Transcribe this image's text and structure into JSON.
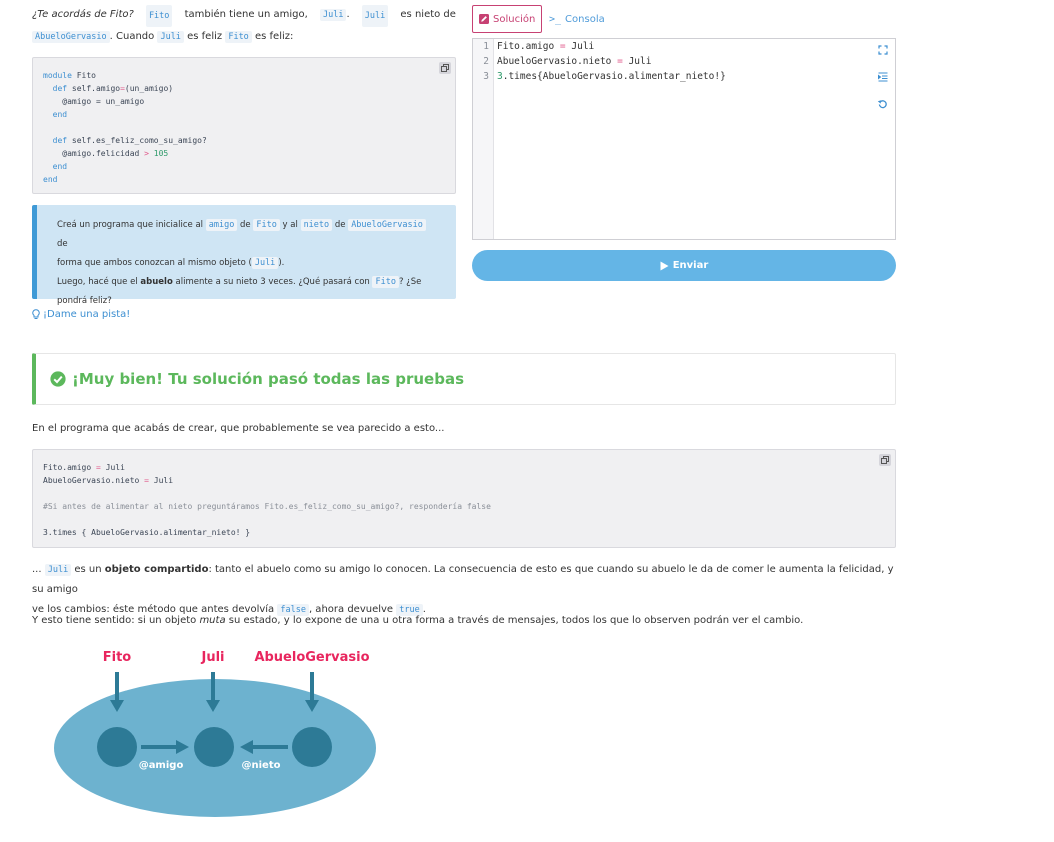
{
  "intro": {
    "q": "¿Te acordás de Fito?",
    "fito": "Fito",
    "t1": " también tiene un amigo, ",
    "juli": "Juli",
    "t2": ". ",
    "t3": " es nieto de",
    "abuelo": "AbueloGervasio",
    "t4": ". Cuando ",
    "t5": " es feliz ",
    "t6": " es feliz:"
  },
  "code1": {
    "l1_kw": "module",
    "l1_rest": " Fito",
    "l2_kw": "def",
    "l2_a": " self.amigo",
    "l2_op": "=",
    "l2_b": "(un_amigo)",
    "l3": "@amigo = un_amigo",
    "l4_kw": "end",
    "l6_kw": "def",
    "l6_rest": " self.es_feliz_como_su_amigo?",
    "l7_a": "@amigo.felicidad ",
    "l7_op": ">",
    "l7_num": " 105",
    "l8_kw": "end",
    "l9_kw": "end"
  },
  "task": {
    "a1": "Creá un programa que inicialice al ",
    "amigo": "amigo",
    "a2": " de ",
    "fito": "Fito",
    "a3": " y al ",
    "nieto": "nieto",
    "a4": " de ",
    "abuelo": "AbueloGervasio",
    "a5": " de",
    "b1": "forma que ambos conozcan al mismo objeto (",
    "juli": "Juli",
    "b2": ").",
    "c1": "Luego, hacé que el ",
    "c_bold": "abuelo",
    "c2": " alimente a su nieto 3 veces. ¿Qué pasará con ",
    "c3": "? ¿Se",
    "d1": "pondrá feliz?"
  },
  "hint_label": "¡Dame una pista!",
  "tabs": {
    "solution": "Solución",
    "console": "Consola"
  },
  "editor": {
    "lines": [
      {
        "n": "1",
        "a": "Fito.amigo ",
        "op": "=",
        "b": " Juli"
      },
      {
        "n": "2",
        "a": "AbueloGervasio.nieto ",
        "op": "=",
        "b": " Juli"
      },
      {
        "n": "3",
        "a": "3",
        "op": "",
        "b": ".times{AbueloGervasio.alimentar_nieto!}"
      }
    ]
  },
  "send_label": "Enviar",
  "success_title": "¡Muy bien! Tu solución pasó todas las pruebas",
  "after_text": "En el programa que acabás de crear, que probablemente se vea parecido a esto...",
  "code2": {
    "l1_a": "Fito.amigo ",
    "l1_op": "=",
    "l1_b": " Juli",
    "l2_a": "AbueloGervasio.nieto ",
    "l2_op": "=",
    "l2_b": " Juli",
    "l4": "#Si antes de alimentar al nieto preguntáramos Fito.es_feliz_como_su_amigo?, respondería false",
    "l6": "3.times { AbueloGervasio.alimentar_nieto! }"
  },
  "shared": {
    "s0": "... ",
    "juli": "Juli",
    "s1": " es un ",
    "bold": "objeto compartido",
    "s2": ": tanto el abuelo como su amigo lo conocen. La consecuencia de esto es que cuando su abuelo le da de comer le aumenta la felicidad, y su amigo",
    "s3": "ve los cambios: éste método que antes devolvía ",
    "false": "false",
    "s4": ", ahora devuelve ",
    "true": "true",
    "s5": "."
  },
  "sense": {
    "a": "Y esto tiene sentido: si un objeto ",
    "muta": "muta",
    "b": " su estado, y lo expone de una u otra forma a través de mensajes, todos los que lo observen podrán ver el cambio."
  },
  "diagram": {
    "fito": "Fito",
    "juli": "Juli",
    "abuelo": "AbueloGervasio",
    "amigo": "@amigo",
    "nieto": "@nieto"
  }
}
